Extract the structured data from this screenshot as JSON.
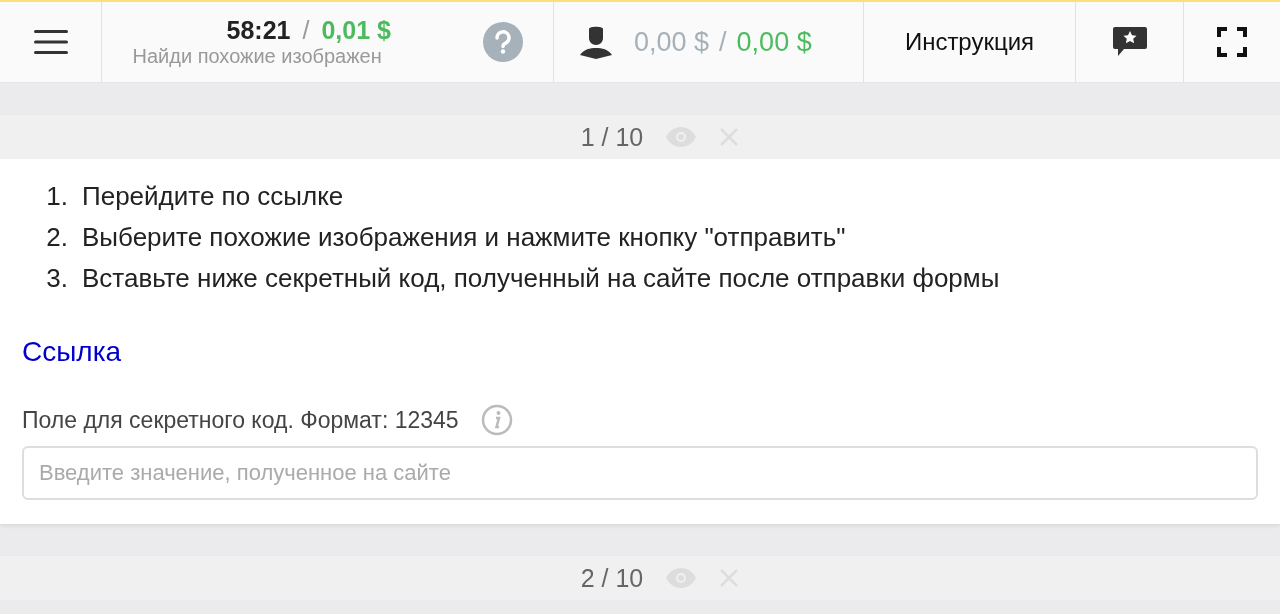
{
  "header": {
    "timer": "58:21",
    "separator": "/",
    "reward": "0,01 $",
    "title": "Найди похожие изображен",
    "balance_pending": "0,00 $",
    "balance_separator": "/",
    "balance": "0,00 $",
    "instruction_button": "Инструкция"
  },
  "tasks": [
    {
      "counter": "1 / 10",
      "instructions": [
        {
          "number": "1.",
          "text": "Перейдите по ссылке"
        },
        {
          "number": "2.",
          "text": "Выберите похожие изображения и нажмите кнопку \"отправить\""
        },
        {
          "number": "3.",
          "text": "Вставьте ниже секретный код, полученный на сайте после отправки формы"
        }
      ],
      "link": "Ссылка",
      "field": {
        "label": "Поле для секретного код. Формат: 12345",
        "placeholder": "Введите значение, полученное на сайте"
      }
    },
    {
      "counter": "2 / 10"
    }
  ]
}
